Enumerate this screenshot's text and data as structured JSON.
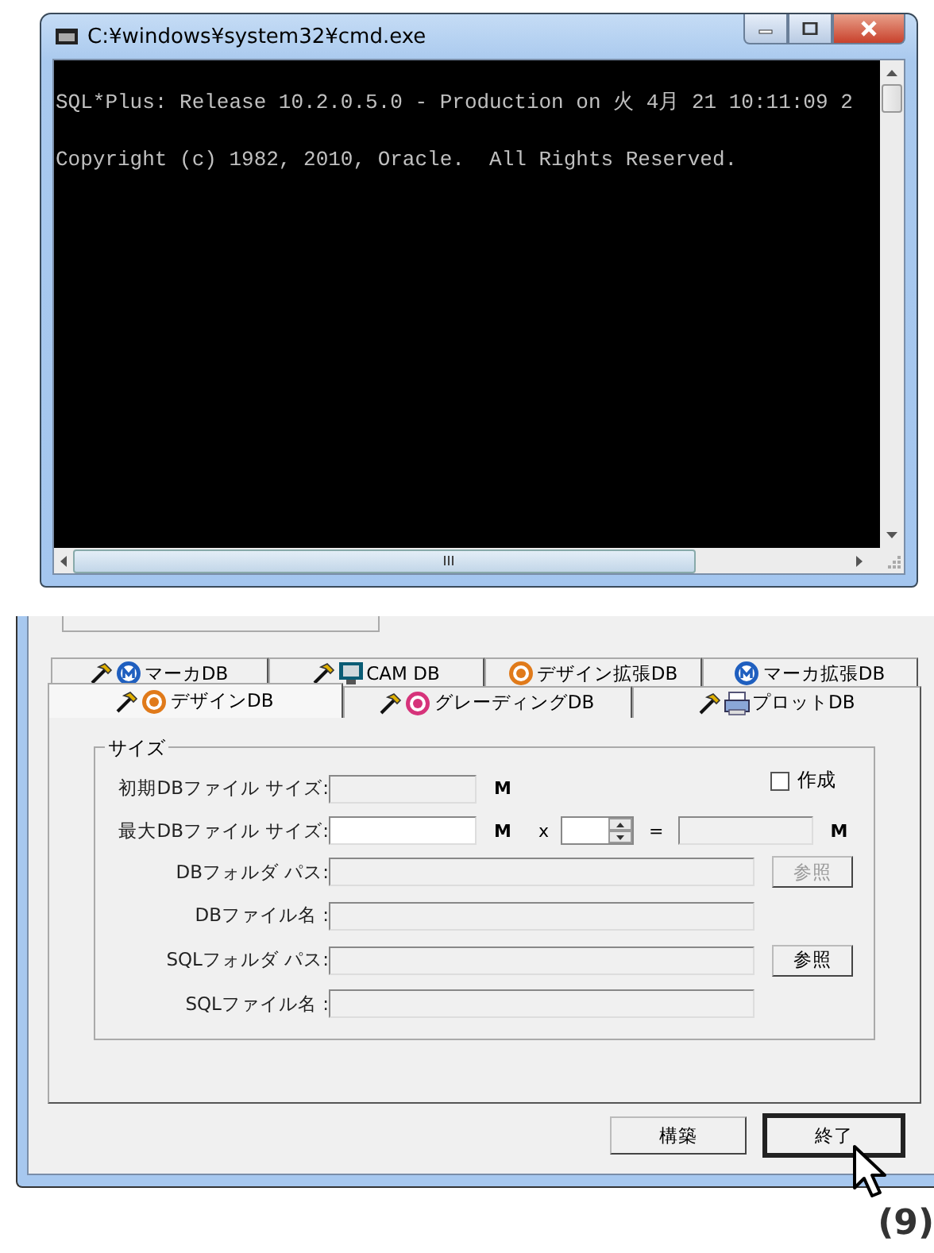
{
  "console_window": {
    "title": "C:¥windows¥system32¥cmd.exe",
    "lines": [
      "SQL*Plus: Release 10.2.0.5.0 - Production on 火 4月 21 10:11:09 2",
      "Copyright (c) 1982, 2010, Oracle.  All Rights Reserved."
    ]
  },
  "dialog": {
    "tab_rows": [
      [
        {
          "label": "マーカDB",
          "kind": "marker",
          "hammer": true,
          "selected": false
        },
        {
          "label": "CAM DB",
          "kind": "cam",
          "hammer": true,
          "selected": false
        },
        {
          "label": "デザイン拡張DB",
          "kind": "design",
          "hammer": false,
          "selected": false
        },
        {
          "label": "マーカ拡張DB",
          "kind": "marker",
          "hammer": false,
          "selected": false
        }
      ],
      [
        {
          "label": "デザインDB",
          "kind": "design",
          "hammer": true,
          "selected": true
        },
        {
          "label": "グレーディングDB",
          "kind": "grading",
          "hammer": true,
          "selected": false
        },
        {
          "label": "プロットDB",
          "kind": "plot",
          "hammer": true,
          "selected": false
        }
      ]
    ],
    "group": {
      "label": "サイズ",
      "rows": [
        {
          "kind": "initial",
          "label": "初期DBファイル サイズ:",
          "field_disabled": true,
          "unit": "M",
          "checkbox": {
            "label": "作成",
            "checked": false
          }
        },
        {
          "kind": "max",
          "label": "最大DBファイル サイズ:",
          "field_disabled": false,
          "unit": "M",
          "times": "x",
          "equals": "=",
          "result_unit": "M"
        },
        {
          "kind": "path",
          "label": "DBフォルダ パス:",
          "field_disabled": true,
          "button": {
            "label": "参照",
            "disabled": true
          }
        },
        {
          "kind": "path",
          "label": "DBファイル名 :",
          "field_disabled": true
        },
        {
          "kind": "path",
          "label": "SQLフォルダ パス:",
          "field_disabled": true,
          "button": {
            "label": "参照",
            "disabled": false
          }
        },
        {
          "kind": "path",
          "label": "SQLファイル名 :",
          "field_disabled": true
        }
      ]
    },
    "buttons": [
      {
        "label": "構築",
        "default": false
      },
      {
        "label": "終了",
        "default": true
      }
    ]
  },
  "annotation": "(9)"
}
